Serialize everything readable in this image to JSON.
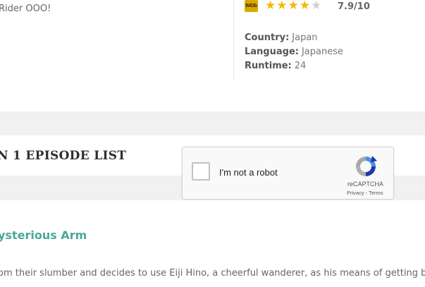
{
  "synopsis": {
    "tail": "Rider OOO!"
  },
  "rating": {
    "source_badge": "IMDb",
    "stars": [
      "full",
      "full",
      "full",
      "full",
      "empty"
    ],
    "value": "7.9/10"
  },
  "details": {
    "country_label": "Country:",
    "country_value": "Japan",
    "language_label": "Language:",
    "language_value": "Japanese",
    "runtime_label": "Runtime:",
    "runtime_value": "24"
  },
  "episodes": {
    "section_title": "N 1 EPISODE LIST",
    "first_episode_title": "ysterious Arm",
    "first_episode_desc": "om their slumber and decides to use Eiji Hino, a cheerful wanderer, as his means of getting back"
  },
  "captcha": {
    "label": "I'm not a robot",
    "brand": "reCAPTCHA",
    "privacy": "Privacy",
    "separator": " - ",
    "terms": "Terms"
  },
  "colors": {
    "accent": "#4aa89a",
    "star": "#f5b800",
    "band": "#f1f1f1"
  }
}
